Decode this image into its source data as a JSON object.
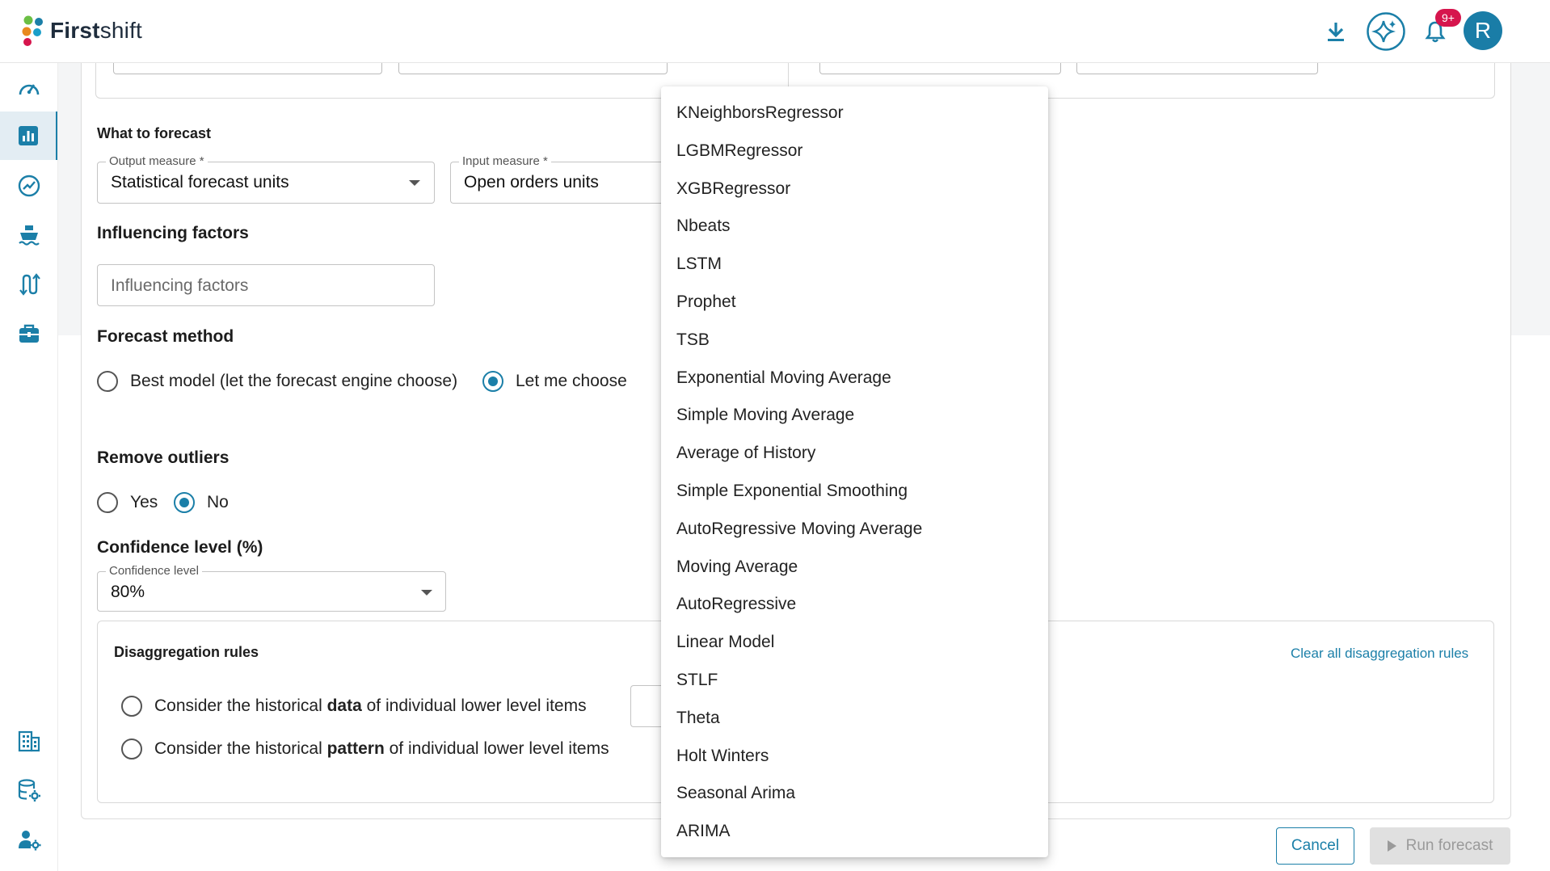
{
  "header": {
    "brand_bold": "First",
    "brand_light": "shift",
    "notification_badge": "9+",
    "avatar_initial": "R"
  },
  "sidebar": {
    "items": [
      {
        "icon": "dashboard-gauge-icon"
      },
      {
        "icon": "bar-chart-icon",
        "active": true
      },
      {
        "icon": "trend-chart-icon"
      },
      {
        "icon": "ship-icon"
      },
      {
        "icon": "route-arrows-icon"
      },
      {
        "icon": "briefcase-icon"
      },
      {
        "icon": "building-icon"
      },
      {
        "icon": "database-settings-icon"
      },
      {
        "icon": "user-settings-icon"
      }
    ]
  },
  "what_to_forecast": {
    "title": "What to forecast",
    "output_measure": {
      "label": "Output measure *",
      "value": "Statistical forecast units"
    },
    "input_measure": {
      "label": "Input measure *",
      "value": "Open orders units"
    }
  },
  "influencing_factors": {
    "title": "Influencing factors",
    "placeholder": "Influencing factors"
  },
  "forecast_method": {
    "title": "Forecast method",
    "options": [
      "Best model (let the forecast engine choose)",
      "Let me choose"
    ],
    "selected": "Let me choose"
  },
  "remove_outliers": {
    "title": "Remove outliers",
    "options": [
      "Yes",
      "No"
    ],
    "selected": "No"
  },
  "confidence_level": {
    "title": "Confidence level (%)",
    "label": "Confidence level",
    "value": "80%"
  },
  "disaggregation": {
    "title": "Disaggregation rules",
    "clear_link": "Clear all disaggregation rules",
    "option1": {
      "pre": "Consider the historical ",
      "bold": "data",
      "post": " of individual lower level items"
    },
    "option2": {
      "pre": "Consider the historical ",
      "bold": "pattern",
      "post": " of individual lower level items"
    }
  },
  "footer": {
    "cancel": "Cancel",
    "run": "Run forecast"
  },
  "model_dropdown": {
    "options": [
      "KNeighborsRegressor",
      "LGBMRegressor",
      "XGBRegressor",
      "Nbeats",
      "LSTM",
      "Prophet",
      "TSB",
      "Exponential Moving Average",
      "Simple Moving Average",
      "Average of History",
      "Simple Exponential Smoothing",
      "AutoRegressive Moving Average",
      "Moving Average",
      "AutoRegressive",
      "Linear Model",
      "STLF",
      "Theta",
      "Holt Winters",
      "Seasonal Arima",
      "ARIMA"
    ]
  },
  "colors": {
    "accent": "#1b7fa8",
    "badge": "#d6154d",
    "sidebar_active_bg": "#e3edf3"
  }
}
